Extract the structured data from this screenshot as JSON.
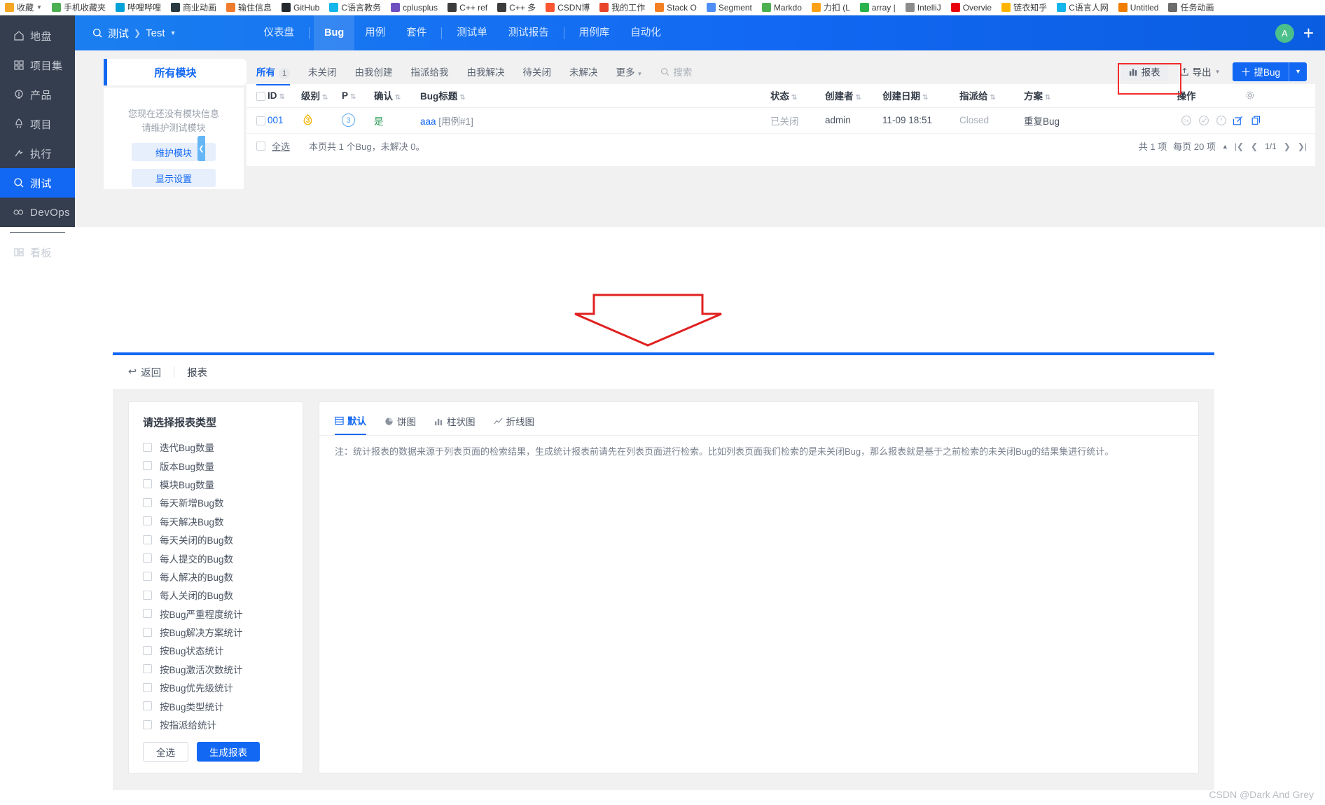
{
  "browser": {
    "bookmarks": [
      {
        "label": "收藏",
        "color": "#f5a623",
        "icon": "star-icon",
        "caret": true
      },
      {
        "label": "手机收藏夹",
        "color": "#4caf50",
        "icon": "bookmark-icon"
      },
      {
        "label": "哔哩哔哩",
        "color": "#00a1d6",
        "icon": "bilibili-icon"
      },
      {
        "label": "商业动画",
        "color": "#2b3a42",
        "icon": "site-icon"
      },
      {
        "label": "输住信息",
        "color": "#ef7b2c",
        "icon": "site-icon"
      },
      {
        "label": "GitHub",
        "color": "#24292e",
        "icon": "github-icon"
      },
      {
        "label": "C语言教务",
        "color": "#13b5ea",
        "icon": "site-icon"
      },
      {
        "label": "cplusplus",
        "color": "#6f4fc0",
        "icon": "site-icon"
      },
      {
        "label": "C++ ref",
        "color": "#3c3c3c",
        "icon": "site-icon"
      },
      {
        "label": "C++ 多",
        "color": "#3c3c3c",
        "icon": "site-icon"
      },
      {
        "label": "CSDN博",
        "color": "#fc5531",
        "icon": "csdn-icon"
      },
      {
        "label": "我的工作",
        "color": "#e8442a",
        "icon": "site-icon"
      },
      {
        "label": "Stack O",
        "color": "#f48024",
        "icon": "stackoverflow-icon"
      },
      {
        "label": "Segment",
        "color": "#4f8ef7",
        "icon": "site-icon"
      },
      {
        "label": "Markdo",
        "color": "#4caf50",
        "icon": "markdown-icon"
      },
      {
        "label": "力扣 (L",
        "color": "#ffa116",
        "icon": "leetcode-icon"
      },
      {
        "label": "array |",
        "color": "#2bb24c",
        "icon": "site-icon"
      },
      {
        "label": "IntelliJ",
        "color": "#8c8c8c",
        "icon": "intellij-icon"
      },
      {
        "label": "Overvie",
        "color": "#e8000d",
        "icon": "site-icon"
      },
      {
        "label": "链衣知乎",
        "color": "#ffb400",
        "icon": "site-icon"
      },
      {
        "label": "C语言人网",
        "color": "#13b5ea",
        "icon": "site-icon"
      },
      {
        "label": "Untitled",
        "color": "#f07c00",
        "icon": "site-icon"
      },
      {
        "label": "任务动画",
        "color": "#6b6b6b",
        "icon": "site-icon"
      }
    ]
  },
  "sidebar": {
    "items": [
      {
        "label": "地盘",
        "icon": "home-icon",
        "active": false
      },
      {
        "label": "项目集",
        "icon": "grid-icon",
        "active": false
      },
      {
        "label": "产品",
        "icon": "bulb-icon",
        "active": false
      },
      {
        "label": "项目",
        "icon": "rocket-icon",
        "active": false
      },
      {
        "label": "执行",
        "icon": "run-icon",
        "active": false
      },
      {
        "label": "测试",
        "icon": "magnifier-icon",
        "active": true
      },
      {
        "label": "DevOps",
        "icon": "infinity-icon",
        "active": false
      },
      {
        "label": "看板",
        "icon": "board-icon",
        "active": false
      }
    ]
  },
  "header": {
    "breadcrumb": {
      "module": "测试",
      "project": "Test"
    },
    "nav": [
      {
        "label": "仪表盘",
        "current": false
      },
      {
        "label": "Bug",
        "current": true
      },
      {
        "label": "用例",
        "current": false
      },
      {
        "label": "套件",
        "current": false
      },
      {
        "label": "测试单",
        "current": false
      },
      {
        "label": "测试报告",
        "current": false
      },
      {
        "label": "用例库",
        "current": false
      },
      {
        "label": "自动化",
        "current": false
      }
    ],
    "avatar_letter": "A",
    "add_label": "+"
  },
  "module_panel": {
    "tab_label": "所有模块",
    "empty_message_line1": "您现在还没有模块信息",
    "empty_message_line2": "请维护测试模块",
    "maintain_button": "维护模块",
    "display_button": "显示设置"
  },
  "filters": {
    "tabs": [
      {
        "label": "所有",
        "count": "1",
        "current": true
      },
      {
        "label": "未关闭",
        "count": "",
        "current": false
      },
      {
        "label": "由我创建",
        "count": "",
        "current": false
      },
      {
        "label": "指派给我",
        "count": "",
        "current": false
      },
      {
        "label": "由我解决",
        "count": "",
        "current": false
      },
      {
        "label": "待关闭",
        "count": "",
        "current": false
      },
      {
        "label": "未解决",
        "count": "",
        "current": false
      },
      {
        "label": "更多",
        "count": "",
        "current": false,
        "caret": true
      }
    ],
    "search_placeholder": "搜索"
  },
  "toolbar": {
    "report_label": "报表",
    "export_label": "导出",
    "new_bug_label": "提Bug"
  },
  "table": {
    "columns": [
      "ID",
      "级别",
      "P",
      "确认",
      "Bug标题",
      "状态",
      "创建者",
      "创建日期",
      "指派给",
      "方案",
      "操作"
    ],
    "rows": [
      {
        "id": "001",
        "severity": "3",
        "priority": "3",
        "confirmed": "是",
        "title_main": "aaa",
        "title_sub": "[用例#1]",
        "status": "已关闭",
        "creator": "admin",
        "created": "11-09 18:51",
        "assigned": "Closed",
        "solution": "重复Bug"
      }
    ],
    "footer": {
      "select_all": "全选",
      "summary": "本页共 1 个Bug，未解决 0。",
      "total": "共 1 项",
      "per_page": "每页 20 项",
      "page_indicator": "1/1"
    }
  },
  "report_page": {
    "back_label": "返回",
    "title": "报表",
    "type_card": {
      "heading": "请选择报表类型",
      "options": [
        "迭代Bug数量",
        "版本Bug数量",
        "模块Bug数量",
        "每天新增Bug数",
        "每天解决Bug数",
        "每天关闭的Bug数",
        "每人提交的Bug数",
        "每人解决的Bug数",
        "每人关闭的Bug数",
        "按Bug严重程度统计",
        "按Bug解决方案统计",
        "按Bug状态统计",
        "按Bug激活次数统计",
        "按Bug优先级统计",
        "按Bug类型统计",
        "按指派给统计"
      ],
      "select_all_label": "全选",
      "generate_label": "生成报表"
    },
    "chart_tabs": [
      {
        "label": "默认",
        "icon": "table-icon",
        "current": true
      },
      {
        "label": "饼图",
        "icon": "pie-chart-icon",
        "current": false
      },
      {
        "label": "柱状图",
        "icon": "bar-chart-icon",
        "current": false
      },
      {
        "label": "折线图",
        "icon": "line-chart-icon",
        "current": false
      }
    ],
    "note": "注：统计报表的数据来源于列表页面的检索结果，生成统计报表前请先在列表页面进行检索。比如列表页面我们检索的是未关闭Bug，那么报表就是基于之前检索的未关闭Bug的结果集进行统计。"
  },
  "watermark": "CSDN @Dark And Grey",
  "colors": {
    "accent": "#1268f3",
    "sidebar": "#343e4e",
    "highlight_box": "#f22c2c",
    "arrow": "#e02020"
  }
}
